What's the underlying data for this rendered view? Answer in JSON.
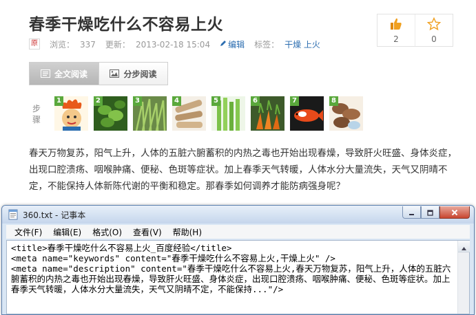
{
  "article": {
    "title": "春季干燥吃什么不容易上火",
    "original_badge": "原",
    "views_label": "浏览：",
    "views_value": "337",
    "updated_label": "更新：",
    "updated_value": "2013-02-18 15:04",
    "edit_label": "编辑",
    "tags_label": "标签：",
    "tags_value": "干燥 上火"
  },
  "votes": {
    "like_count": "2",
    "favorite_count": "0"
  },
  "read_tabs": [
    {
      "label": "全文阅读",
      "active": true
    },
    {
      "label": "分步阅读",
      "active": false
    }
  ],
  "steps": {
    "label": "步骤",
    "thumbnails": [
      {
        "num": "1"
      },
      {
        "num": "2"
      },
      {
        "num": "3"
      },
      {
        "num": "4"
      },
      {
        "num": "5"
      },
      {
        "num": "6"
      },
      {
        "num": "7"
      },
      {
        "num": "8"
      }
    ]
  },
  "intro": "春天万物复苏，阳气上升，人体的五脏六腑蓄积的内热之毒也开始出现春燥，导致肝火旺盛、身体炎症，出现口腔溃疡、咽喉肿痛、便秘、色斑等症状。加上春季天气转暖，人体水分大量流失，天气又阴晴不定，不能保持人体新陈代谢的平衡和稳定。那春季如何调养才能防病强身呢？",
  "notepad": {
    "title": "360.txt - 记事本",
    "menus": [
      "文件(F)",
      "编辑(E)",
      "格式(O)",
      "查看(V)",
      "帮助(H)"
    ],
    "lines": [
      "<title>春季干燥吃什么不容易上火_百度经验</title>",
      "<meta name=\"keywords\" content=\"春季干燥吃什么不容易上火,干燥上火\" />",
      "<meta name=\"description\" content=\"春季干燥吃什么不容易上火,春天万物复苏，阳气上升，人体的五脏六腑蓄积的内热之毒也开始出现春燥，导致肝火旺盛、身体炎症，出现口腔溃疡、咽喉肿痛、便秘、色斑等症状。加上春季天气转暖，人体水分大量流失，天气又阴晴不定，不能保持...\"/>"
    ]
  },
  "colors": {
    "link": "#2b6db0",
    "step_badge": "#5aa83c",
    "like": "#f0a020"
  }
}
